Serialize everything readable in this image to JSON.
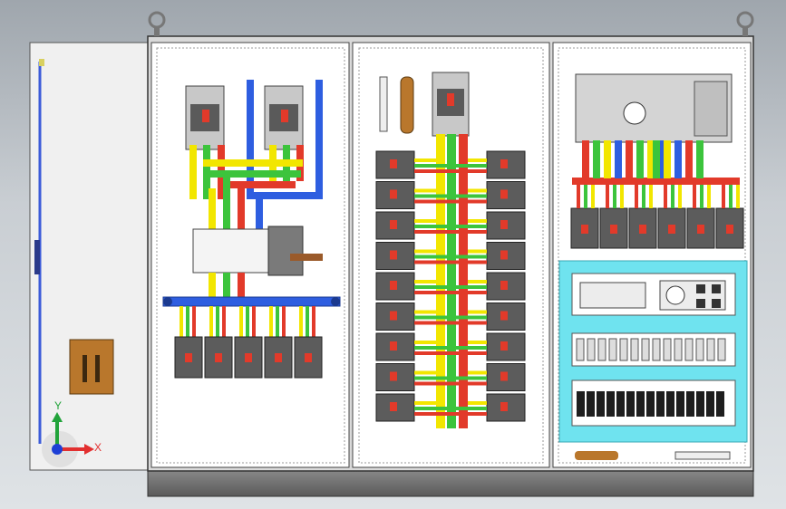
{
  "viewport": {
    "background_top": "#9fa6ad",
    "background_bottom": "#dfe3e6"
  },
  "triad": {
    "y_label": "Y",
    "x_label": "X",
    "y_color": "#21a33a",
    "x_color": "#e23030",
    "z_color": "#1d3fd6"
  },
  "colors": {
    "panel": "#ffffff",
    "frame": "#e8e8e8",
    "bus_yellow": "#f2e600",
    "bus_green": "#3cc43c",
    "bus_red": "#e23a2a",
    "bus_blue": "#2e5ee0",
    "breaker": "#5c5c5c",
    "cyan": "#6fe3ef",
    "handle": "#b9772c"
  }
}
